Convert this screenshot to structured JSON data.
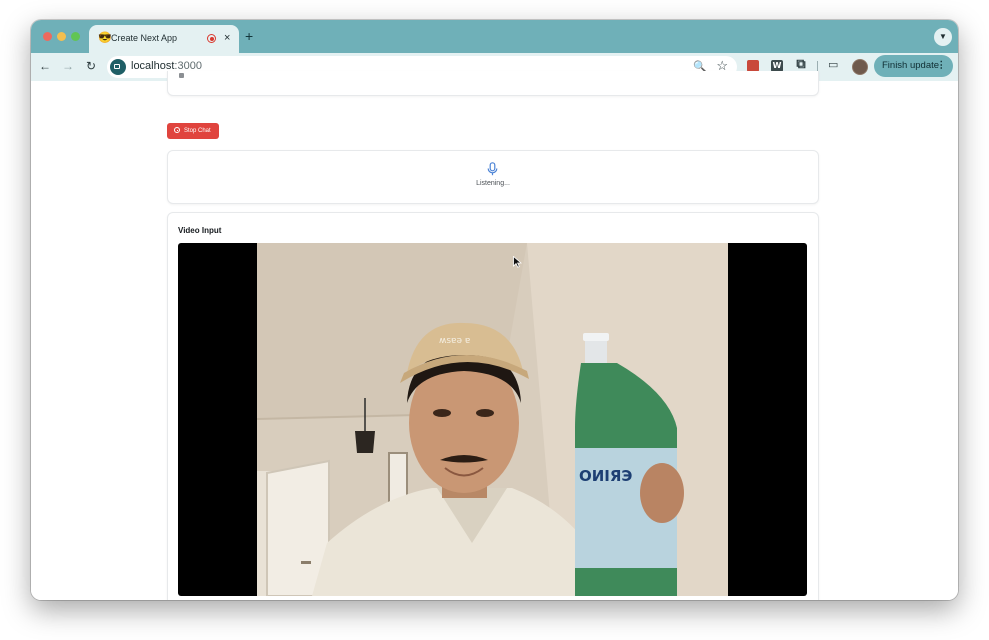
{
  "browser": {
    "tab": {
      "title": "Create Next App",
      "favicon": "next-app-favicon-icon",
      "recording_indicator": "recording-icon",
      "close_label": "×"
    },
    "new_tab_label": "+",
    "tab_dropdown_label": "⌄",
    "back_label": "←",
    "forward_label": "→",
    "reload_label": "↻",
    "url": {
      "host": "localhost",
      "port": ":3000"
    },
    "zoom_label": "🔍",
    "bookmark_label": "☆",
    "extensions": [
      {
        "name": "red-extension-icon",
        "label": ""
      },
      {
        "name": "w-extension-icon",
        "label": "W"
      }
    ],
    "puzzle_label": "⧉",
    "cast_label": "▭",
    "finish_update_label": "Finish update",
    "menu_label": "⋮",
    "accent_color": "#6fb0b8"
  },
  "page": {
    "stop_chat_label": "Stop Chat",
    "stop_chat_color": "#e0443e",
    "listening_status": "Listening...",
    "video_section_title": "Video Input"
  }
}
